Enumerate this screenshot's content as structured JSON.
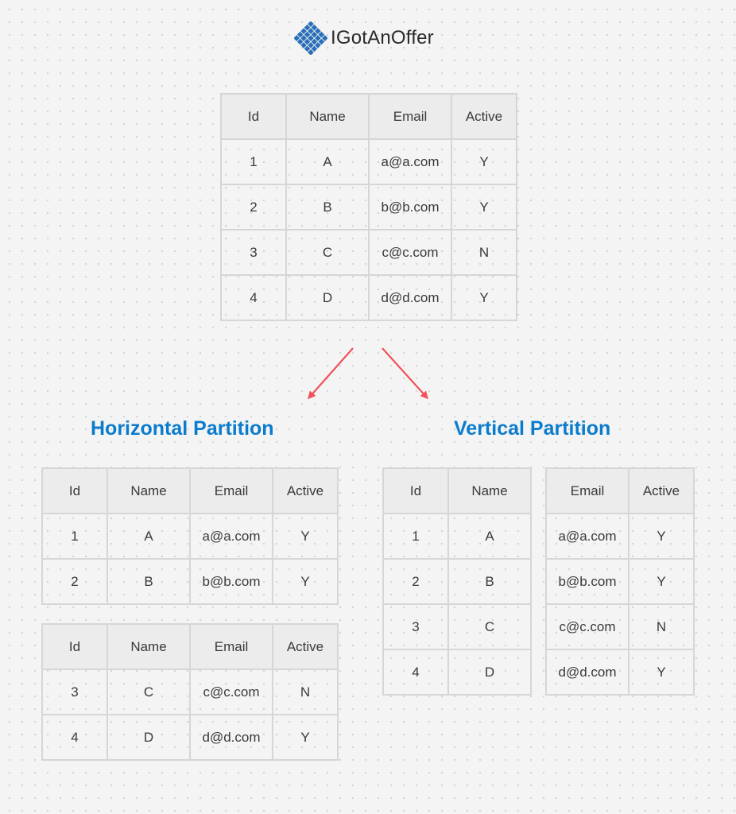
{
  "brand": {
    "name": "IGotAnOffer",
    "logo_color": "#2a6fb7"
  },
  "headings": {
    "horizontal": "Horizontal Partition",
    "vertical": "Vertical Partition"
  },
  "accent_color": "#0b7ccd",
  "arrow_color": "#f0525a",
  "columns": {
    "id": "Id",
    "name": "Name",
    "email": "Email",
    "active": "Active"
  },
  "original_table": {
    "rows": [
      {
        "id": "1",
        "name": "A",
        "email": "a@a.com",
        "active": "Y"
      },
      {
        "id": "2",
        "name": "B",
        "email": "b@b.com",
        "active": "Y"
      },
      {
        "id": "3",
        "name": "C",
        "email": "c@c.com",
        "active": "N"
      },
      {
        "id": "4",
        "name": "D",
        "email": "d@d.com",
        "active": "Y"
      }
    ]
  },
  "horizontal_partition": {
    "part1": {
      "rows": [
        {
          "id": "1",
          "name": "A",
          "email": "a@a.com",
          "active": "Y"
        },
        {
          "id": "2",
          "name": "B",
          "email": "b@b.com",
          "active": "Y"
        }
      ]
    },
    "part2": {
      "rows": [
        {
          "id": "3",
          "name": "C",
          "email": "c@c.com",
          "active": "N"
        },
        {
          "id": "4",
          "name": "D",
          "email": "d@d.com",
          "active": "Y"
        }
      ]
    }
  },
  "vertical_partition": {
    "left": {
      "rows": [
        {
          "id": "1",
          "name": "A"
        },
        {
          "id": "2",
          "name": "B"
        },
        {
          "id": "3",
          "name": "C"
        },
        {
          "id": "4",
          "name": "D"
        }
      ]
    },
    "right": {
      "rows": [
        {
          "email": "a@a.com",
          "active": "Y"
        },
        {
          "email": "b@b.com",
          "active": "Y"
        },
        {
          "email": "c@c.com",
          "active": "N"
        },
        {
          "email": "d@d.com",
          "active": "Y"
        }
      ]
    }
  }
}
